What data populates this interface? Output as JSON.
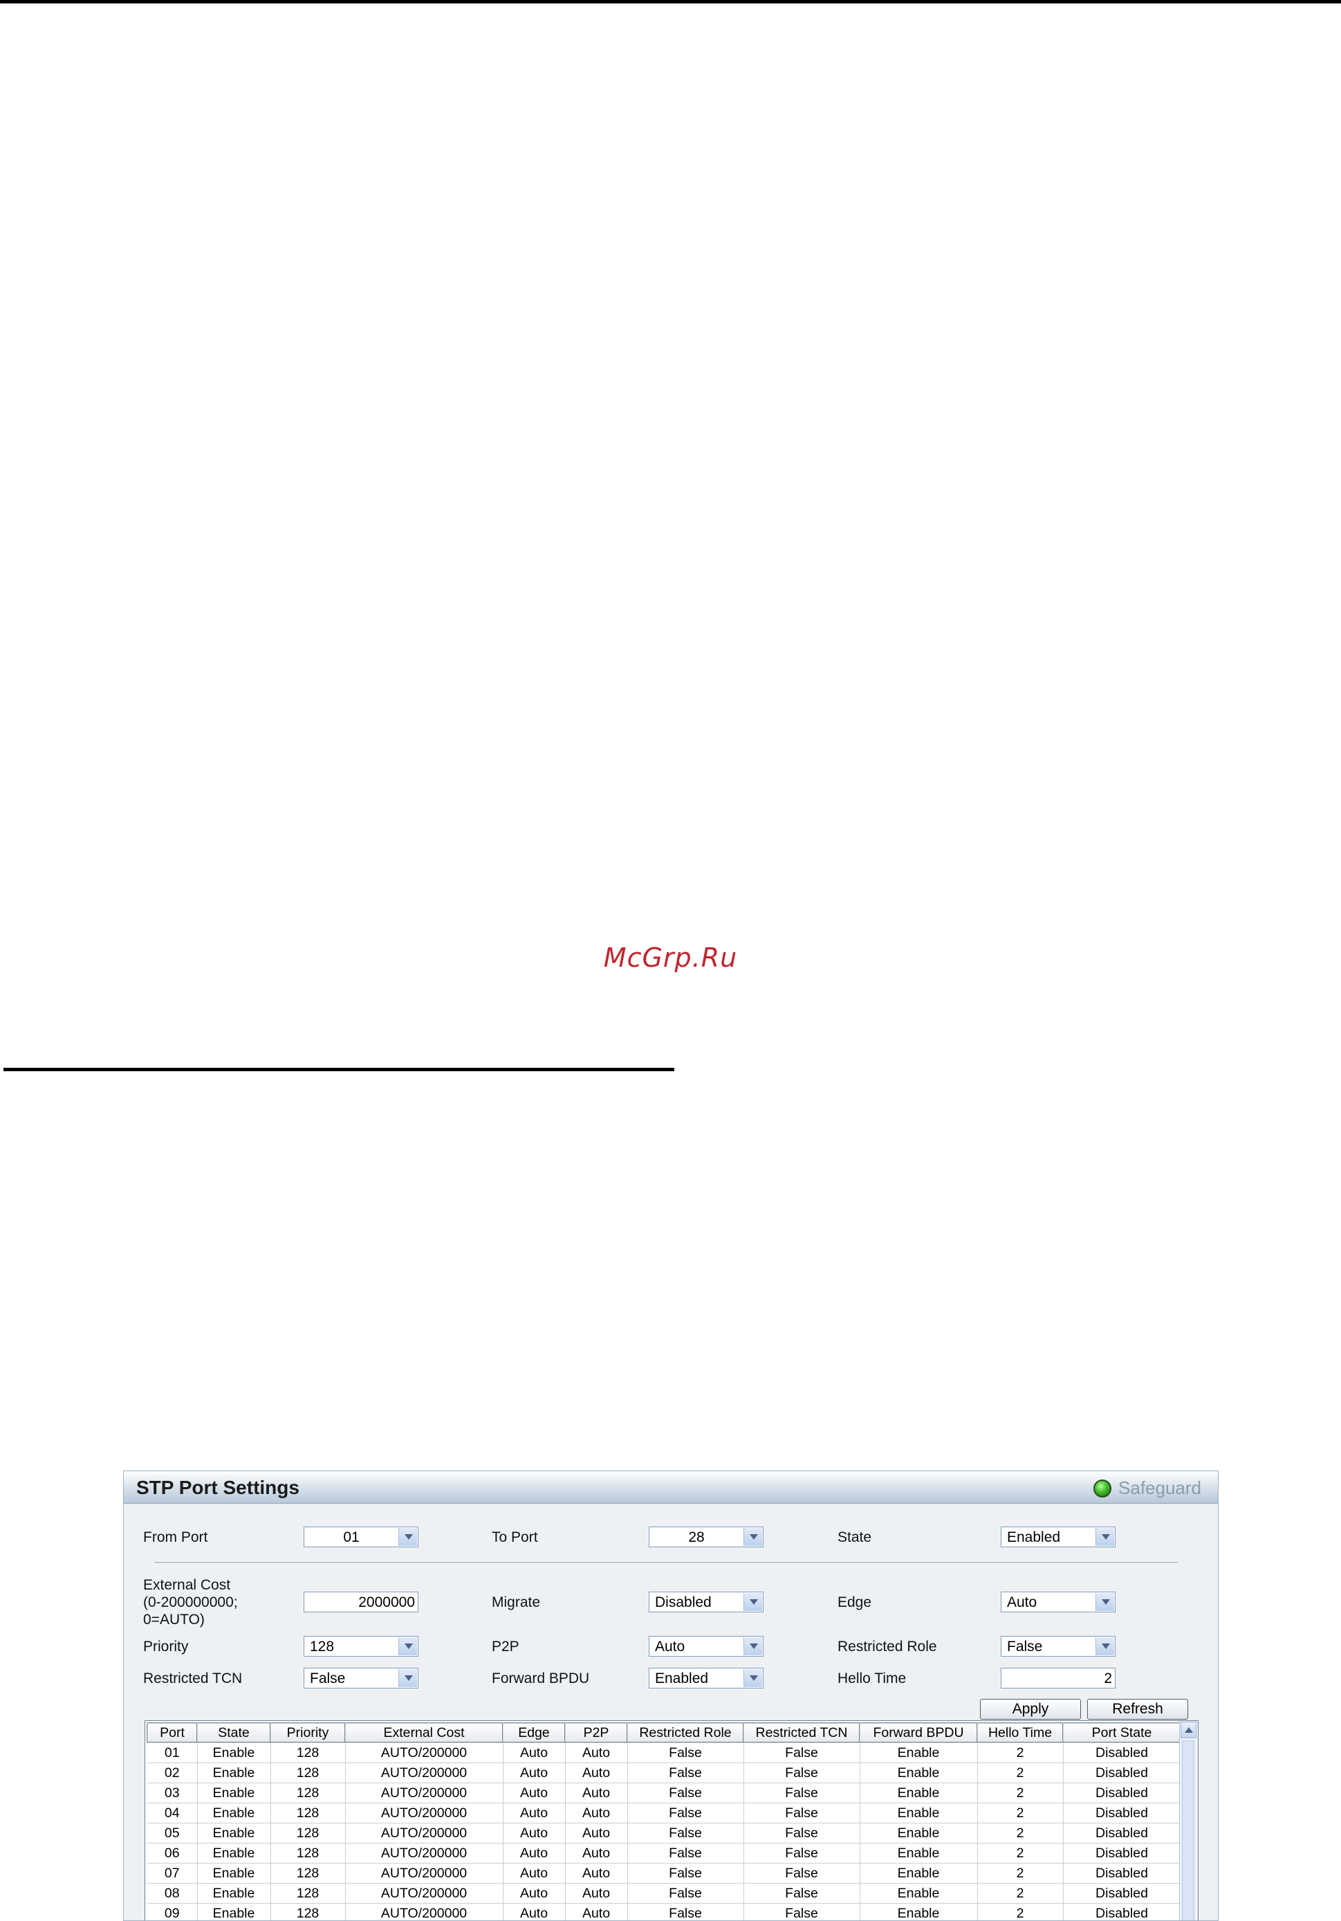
{
  "page": {
    "watermark": "McGrp.Ru"
  },
  "panel": {
    "title": "STP Port Settings",
    "safeguard_label": "Safeguard"
  },
  "form": {
    "from_port": {
      "label": "From Port",
      "value": "01"
    },
    "to_port": {
      "label": "To Port",
      "value": "28"
    },
    "state": {
      "label": "State",
      "value": "Enabled"
    },
    "external_cost": {
      "label_line1": "External Cost",
      "label_line2": "(0-200000000;",
      "label_line3": "0=AUTO)",
      "value": "2000000"
    },
    "migrate": {
      "label": "Migrate",
      "value": "Disabled"
    },
    "edge": {
      "label": "Edge",
      "value": "Auto"
    },
    "priority": {
      "label": "Priority",
      "value": "128"
    },
    "p2p": {
      "label": "P2P",
      "value": "Auto"
    },
    "restricted_role": {
      "label": "Restricted Role",
      "value": "False"
    },
    "restricted_tcn": {
      "label": "Restricted TCN",
      "value": "False"
    },
    "forward_bpdu": {
      "label": "Forward BPDU",
      "value": "Enabled"
    },
    "hello_time": {
      "label": "Hello Time",
      "value": "2"
    },
    "apply_label": "Apply",
    "refresh_label": "Refresh"
  },
  "table": {
    "headers": [
      "Port",
      "State",
      "Priority",
      "External Cost",
      "Edge",
      "P2P",
      "Restricted Role",
      "Restricted TCN",
      "Forward BPDU",
      "Hello Time",
      "Port State"
    ],
    "rows": [
      [
        "01",
        "Enable",
        "128",
        "AUTO/200000",
        "Auto",
        "Auto",
        "False",
        "False",
        "Enable",
        "2",
        "Disabled"
      ],
      [
        "02",
        "Enable",
        "128",
        "AUTO/200000",
        "Auto",
        "Auto",
        "False",
        "False",
        "Enable",
        "2",
        "Disabled"
      ],
      [
        "03",
        "Enable",
        "128",
        "AUTO/200000",
        "Auto",
        "Auto",
        "False",
        "False",
        "Enable",
        "2",
        "Disabled"
      ],
      [
        "04",
        "Enable",
        "128",
        "AUTO/200000",
        "Auto",
        "Auto",
        "False",
        "False",
        "Enable",
        "2",
        "Disabled"
      ],
      [
        "05",
        "Enable",
        "128",
        "AUTO/200000",
        "Auto",
        "Auto",
        "False",
        "False",
        "Enable",
        "2",
        "Disabled"
      ],
      [
        "06",
        "Enable",
        "128",
        "AUTO/200000",
        "Auto",
        "Auto",
        "False",
        "False",
        "Enable",
        "2",
        "Disabled"
      ],
      [
        "07",
        "Enable",
        "128",
        "AUTO/200000",
        "Auto",
        "Auto",
        "False",
        "False",
        "Enable",
        "2",
        "Disabled"
      ],
      [
        "08",
        "Enable",
        "128",
        "AUTO/200000",
        "Auto",
        "Auto",
        "False",
        "False",
        "Enable",
        "2",
        "Disabled"
      ],
      [
        "09",
        "Enable",
        "128",
        "AUTO/200000",
        "Auto",
        "Auto",
        "False",
        "False",
        "Enable",
        "2",
        "Disabled"
      ]
    ]
  }
}
